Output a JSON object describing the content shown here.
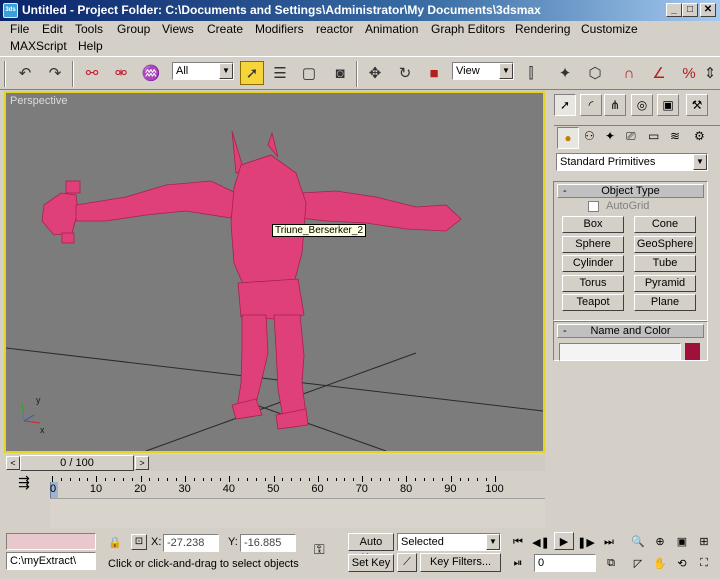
{
  "titlebar": {
    "icon": "3ds",
    "title": "Untitled    - Project Folder: C:\\Documents and Settings\\Administrator\\My Documents\\3dsmax",
    "min": "_",
    "max": "□",
    "close": "✕"
  },
  "menu": {
    "row1": [
      "File",
      "Edit",
      "Tools",
      "Group",
      "Views",
      "Create",
      "Modifiers",
      "reactor",
      "Animation",
      "Graph Editors",
      "Rendering",
      "Customize"
    ],
    "row2": [
      "MAXScript",
      "Help"
    ]
  },
  "toolbar": {
    "selection_filter": "All",
    "ref_coord": "View"
  },
  "viewport": {
    "label": "Perspective",
    "tooltip": "Triune_Berserker_2",
    "model_color": "#e0407a",
    "border_color": "#e6d420"
  },
  "panel": {
    "category": "Standard Primitives",
    "object_type_title": "Object Type",
    "autogrid": "AutoGrid",
    "buttons": [
      "Box",
      "Cone",
      "Sphere",
      "GeoSphere",
      "Cylinder",
      "Tube",
      "Torus",
      "Pyramid",
      "Teapot",
      "Plane"
    ],
    "name_color_title": "Name and Color",
    "name_value": "",
    "swatch_color": "#a0103a",
    "collapse": "-"
  },
  "timeline": {
    "frame_counter": "0 / 100",
    "prev": "<",
    "next": ">",
    "ticks": [
      "0",
      "10",
      "20",
      "30",
      "40",
      "50",
      "60",
      "70",
      "80",
      "90",
      "100"
    ]
  },
  "status": {
    "maxscript_listener": "C:\\myExtract\\",
    "x_label": "X:",
    "x_value": "-27.238",
    "y_label": "Y:",
    "y_value": "-16.885",
    "prompt": "Click or click-and-drag to select objects",
    "auto_key": "Auto Key",
    "set_key": "Set Key",
    "key_mode": "Selected",
    "key_filters": "Key Filters...",
    "current_frame": "0"
  }
}
